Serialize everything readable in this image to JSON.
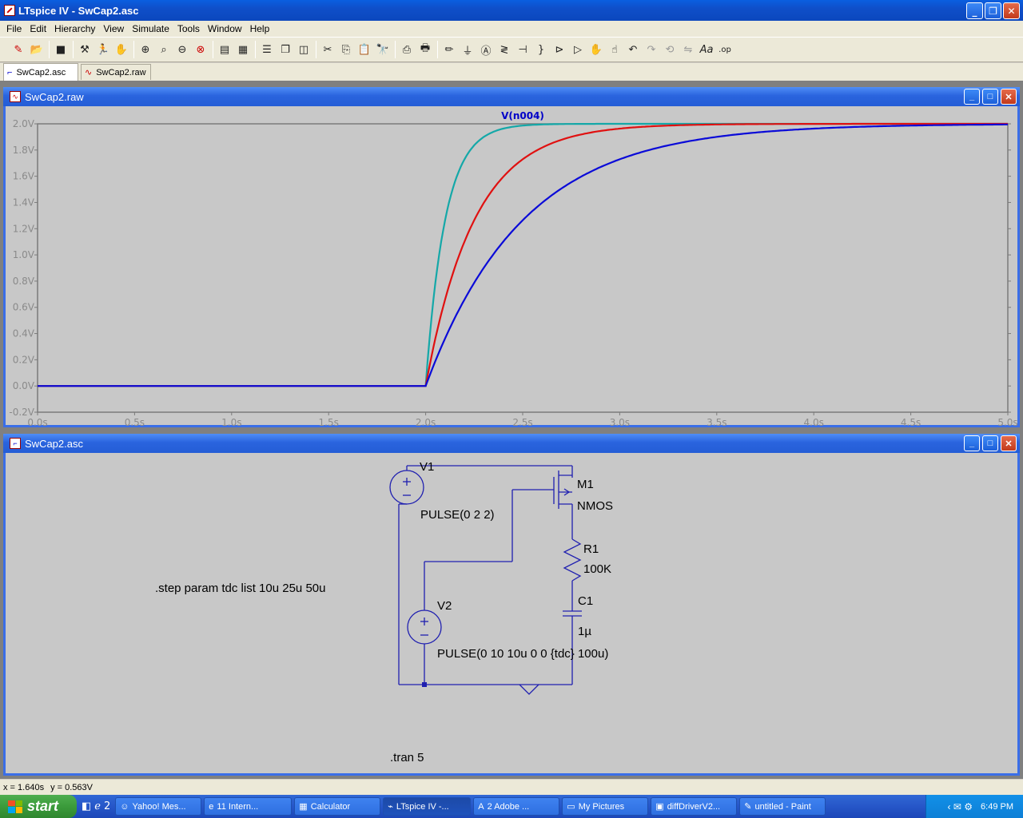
{
  "window": {
    "title": "LTspice IV - SwCap2.asc",
    "min": "_",
    "max": "❐",
    "close": "✕"
  },
  "menu": [
    "File",
    "Edit",
    "Hierarchy",
    "View",
    "Simulate",
    "Tools",
    "Window",
    "Help"
  ],
  "toolbar_icons": [
    "run-icon",
    "open-icon",
    "save-icon",
    "control-panel-icon",
    "run-sim-icon",
    "pan-icon",
    "zoom-in-icon",
    "zoom-fit-icon",
    "zoom-out-icon",
    "zoom-cancel-icon",
    "autorange-icon",
    "grid-icon",
    "tile-horizontal-icon",
    "cascade-icon",
    "tile-vertical-icon",
    "cut-icon",
    "copy-icon",
    "paste-icon",
    "find-icon",
    "print-setup-icon",
    "print-icon",
    "wire-icon",
    "ground-icon",
    "label-icon",
    "resistor-icon",
    "capacitor-icon",
    "inductor-icon",
    "diode-icon",
    "component-icon",
    "move-icon",
    "drag-icon",
    "undo-icon",
    "redo-icon",
    "rotate-icon",
    "mirror-icon",
    "text-icon",
    "spice-directive-icon"
  ],
  "tabs": [
    {
      "label": "SwCap2.asc",
      "icon": "schematic-icon",
      "active": true
    },
    {
      "label": "SwCap2.raw",
      "icon": "waveform-icon",
      "active": false
    }
  ],
  "plot_window": {
    "title": "SwCap2.raw",
    "trace_label": "V(n004)",
    "trace_label_color": "#0000c8",
    "axis_color": "#7a7a7a",
    "background": "#c8c8c8"
  },
  "chart_data": {
    "type": "line",
    "title": "V(n004)",
    "x_ticks": [
      "0.0s",
      "0.5s",
      "1.0s",
      "1.5s",
      "2.0s",
      "2.5s",
      "3.0s",
      "3.5s",
      "4.0s",
      "4.5s",
      "5.0s"
    ],
    "y_ticks": [
      "-0.2V",
      "0.0V",
      "0.2V",
      "0.4V",
      "0.6V",
      "0.8V",
      "1.0V",
      "1.2V",
      "1.4V",
      "1.6V",
      "1.8V",
      "2.0V"
    ],
    "xlim": [
      0,
      5
    ],
    "ylim": [
      -0.2,
      2.0
    ],
    "grid": false,
    "series": [
      {
        "color": "#14a8a8",
        "step_time": 2.0,
        "final": 2.0,
        "tau": 0.1
      },
      {
        "color": "#e01010",
        "step_time": 2.0,
        "final": 2.0,
        "tau": 0.25
      },
      {
        "color": "#0a0ad8",
        "step_time": 2.0,
        "final": 2.0,
        "tau": 0.5
      }
    ]
  },
  "schematic_window": {
    "title": "SwCap2.asc",
    "wire_color": "#2020b0",
    "labels": {
      "v1": "V1",
      "v1_value": "PULSE(0 2 2)",
      "m1": "M1",
      "m1_model": "NMOS",
      "r1": "R1",
      "r1_value": "100K",
      "c1": "C1",
      "c1_value": "1µ",
      "v2": "V2",
      "v2_value": "PULSE(0 10 10u 0 0 {tdc} 100u)",
      "step_directive": ".step param tdc list 10u 25u 50u",
      "tran_directive": ".tran 5"
    }
  },
  "status": {
    "x": "x = 1.640s",
    "y": "y = 0.563V"
  },
  "taskbar": {
    "start": "start",
    "items": [
      {
        "label": "Yahoo! Mes...",
        "icon": "☺",
        "active": false
      },
      {
        "label": "11 Intern...",
        "icon": "e",
        "active": false
      },
      {
        "label": "Calculator",
        "icon": "▦",
        "active": false
      },
      {
        "label": "LTspice IV -...",
        "icon": "⌁",
        "active": true
      },
      {
        "label": "2 Adobe ...",
        "icon": "A",
        "active": false
      },
      {
        "label": "My Pictures",
        "icon": "▭",
        "active": false
      },
      {
        "label": "diffDriverV2...",
        "icon": "▣",
        "active": false
      },
      {
        "label": "untitled - Paint",
        "icon": "✎",
        "active": false
      }
    ],
    "clock": "6:49 PM"
  }
}
